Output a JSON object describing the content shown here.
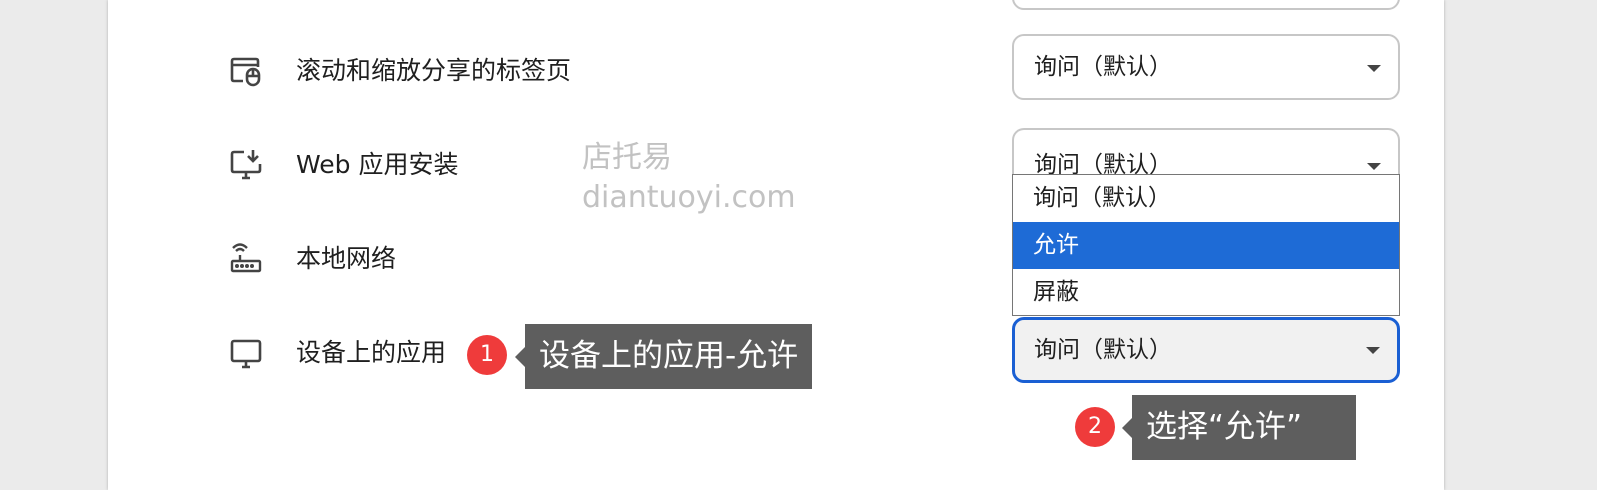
{
  "rows": [
    {
      "label": "滚动和缩放分享的标签页",
      "value": "询问（默认）",
      "icon": "tab-scroll-zoom-icon"
    },
    {
      "label": "Web 应用安装",
      "value": "询问（默认）",
      "icon": "install-desktop-icon"
    },
    {
      "label": "本地网络",
      "value": "",
      "icon": "router-icon"
    },
    {
      "label": "设备上的应用",
      "value": "询问（默认）",
      "icon": "desktop-monitor-icon"
    }
  ],
  "dropdown": {
    "options": [
      "询问（默认）",
      "允许",
      "屏蔽"
    ],
    "highlighted_index": 1
  },
  "watermark": {
    "line1": "店托易",
    "line2": "diantuoyi.com"
  },
  "annotations": [
    {
      "number": "1",
      "text": "设备上的应用-允许"
    },
    {
      "number": "2",
      "text": "选择“允许”"
    }
  ],
  "colors": {
    "accent": "#1a5fd3",
    "highlight": "#1e6bd6",
    "badge": "#ef3b3b",
    "callout": "#5e5e5e"
  }
}
